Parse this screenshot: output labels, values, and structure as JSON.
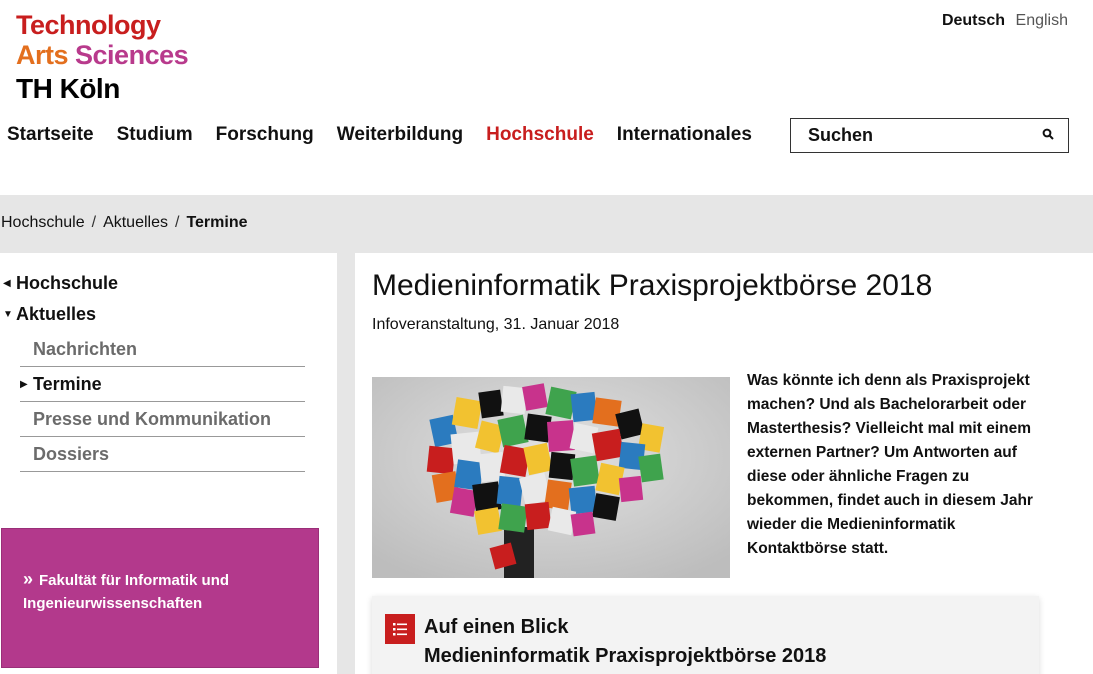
{
  "logo": {
    "line1": "Technology",
    "line2a": "Arts",
    "line2b": "Sciences",
    "line3": "TH Köln"
  },
  "lang": {
    "active": "Deutsch",
    "other": "English"
  },
  "nav": [
    {
      "label": "Startseite",
      "active": false
    },
    {
      "label": "Studium",
      "active": false
    },
    {
      "label": "Forschung",
      "active": false
    },
    {
      "label": "Weiterbildung",
      "active": false
    },
    {
      "label": "Hochschule",
      "active": true
    },
    {
      "label": "Internationales",
      "active": false
    }
  ],
  "search": {
    "placeholder": "Suchen",
    "icon": "search-icon"
  },
  "breadcrumb": {
    "items": [
      "Hochschule",
      "Aktuelles"
    ],
    "current": "Termine",
    "separator": "/"
  },
  "sidebar": {
    "parent": "Hochschule",
    "section": "Aktuelles",
    "items": [
      "Nachrichten",
      "Termine",
      "Presse und Kommunikation",
      "Dossiers"
    ],
    "faculty_link": "Fakultät für Informatik und Ingenieurwissenschaften"
  },
  "article": {
    "title": "Medieninformatik Praxisprojektbörse 2018",
    "subtitle": "Infoveranstaltung, 31. Januar 2018",
    "intro": "Was könnte ich denn als Praxisprojekt machen? Und als Bachelorarbeit oder Masterthesis? Vielleicht mal mit einem externen Partner? Um Antworten auf diese oder ähnliche Fragen zu bekommen, findet auch in diesem Jahr wieder die Medieninformatik Kontaktbörse statt.",
    "glance_title": "Auf einen Blick",
    "glance_subtitle": "Medieninformatik Praxisprojektbörse 2018"
  },
  "colors": {
    "brand_red": "#c81e1e",
    "brand_orange": "#e36f1e",
    "brand_magenta": "#b3398c"
  }
}
